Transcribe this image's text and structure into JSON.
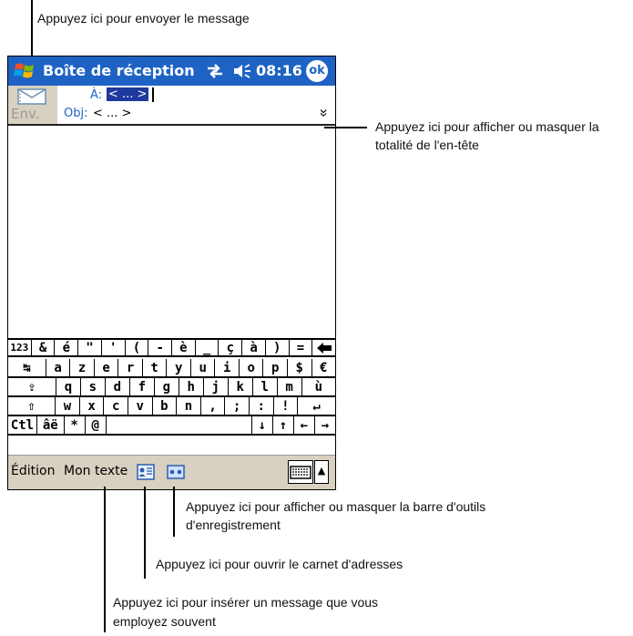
{
  "callouts": {
    "send": "Appuyez ici pour envoyer le message",
    "header_toggle_line1": "Appuyez ici pour afficher ou masquer la",
    "header_toggle_line2": "totalité de l'en-tête",
    "recording_line1": "Appuyez ici pour afficher ou masquer la barre d'outils",
    "recording_line2": "d'enregistrement",
    "address_book": "Appuyez ici pour ouvrir le carnet d'adresses",
    "my_text_line1": "Appuyez ici pour insérer un message que vous",
    "my_text_line2": "employez souvent"
  },
  "titlebar": {
    "title": "Boîte de réception",
    "time": "08:16",
    "ok_label": "ok",
    "connectivity_icon": "connectivity-icon",
    "volume_icon": "speaker-icon",
    "start_icon": "windows-flag-icon"
  },
  "header": {
    "send_label": "Env.",
    "to_label": "À:",
    "to_value": "< ... >",
    "subject_label": "Obj:",
    "subject_value": "< ... >",
    "expand_glyph": "»"
  },
  "keyboard": {
    "rows": [
      [
        "123",
        "&",
        "é",
        "\"",
        "'",
        "(",
        "-",
        "è",
        "_",
        "ç",
        "à",
        ")",
        "=",
        "◆"
      ],
      [
        "↹",
        "a",
        "z",
        "e",
        "r",
        "t",
        "y",
        "u",
        "i",
        "o",
        "p",
        "$",
        "€"
      ],
      [
        "⇪",
        "q",
        "s",
        "d",
        "f",
        "g",
        "h",
        "j",
        "k",
        "l",
        "m",
        "ù"
      ],
      [
        "⇧",
        "w",
        "x",
        "c",
        "v",
        "b",
        "n",
        ",",
        ";",
        ":",
        "!",
        "↵"
      ],
      [
        "Ctl",
        "âë",
        "*",
        "@",
        "",
        "↓",
        "↑",
        "←",
        "→"
      ]
    ]
  },
  "toolbar": {
    "edit_label": "Édition",
    "my_text_label": "Mon texte",
    "address_book_icon": "address-card-icon",
    "recording_icon": "cassette-icon",
    "keyboard_icon": "keyboard-icon",
    "sip_arrow": "▲"
  },
  "colors": {
    "titlebar": "#1e63c4",
    "toolbar": "#d8d0c0",
    "selection": "#1e3a9e"
  }
}
